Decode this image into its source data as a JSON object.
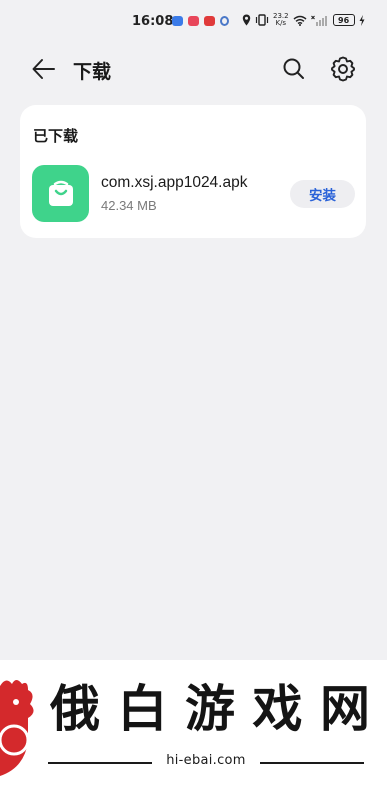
{
  "status_bar": {
    "time": "16:08",
    "network_speed_value": "23.2",
    "network_speed_unit": "K/s",
    "battery": "96"
  },
  "header": {
    "title": "下载",
    "back_icon": "arrow-left-icon",
    "search_icon": "search-icon",
    "settings_icon": "gear-icon"
  },
  "downloaded": {
    "section_title": "已下载",
    "items": [
      {
        "file_name": "com.xsj.app1024.apk",
        "size": "42.34 MB",
        "action_label": "安装",
        "icon": "shopping-bag-icon",
        "icon_color": "#3fd38b"
      }
    ]
  },
  "watermark": {
    "chars": [
      "俄",
      "白",
      "游",
      "戏",
      "网"
    ],
    "url": "hi-ebai.com"
  },
  "colors": {
    "background": "#f1f1f3",
    "card": "#ffffff",
    "accent": "#2a62d8"
  }
}
